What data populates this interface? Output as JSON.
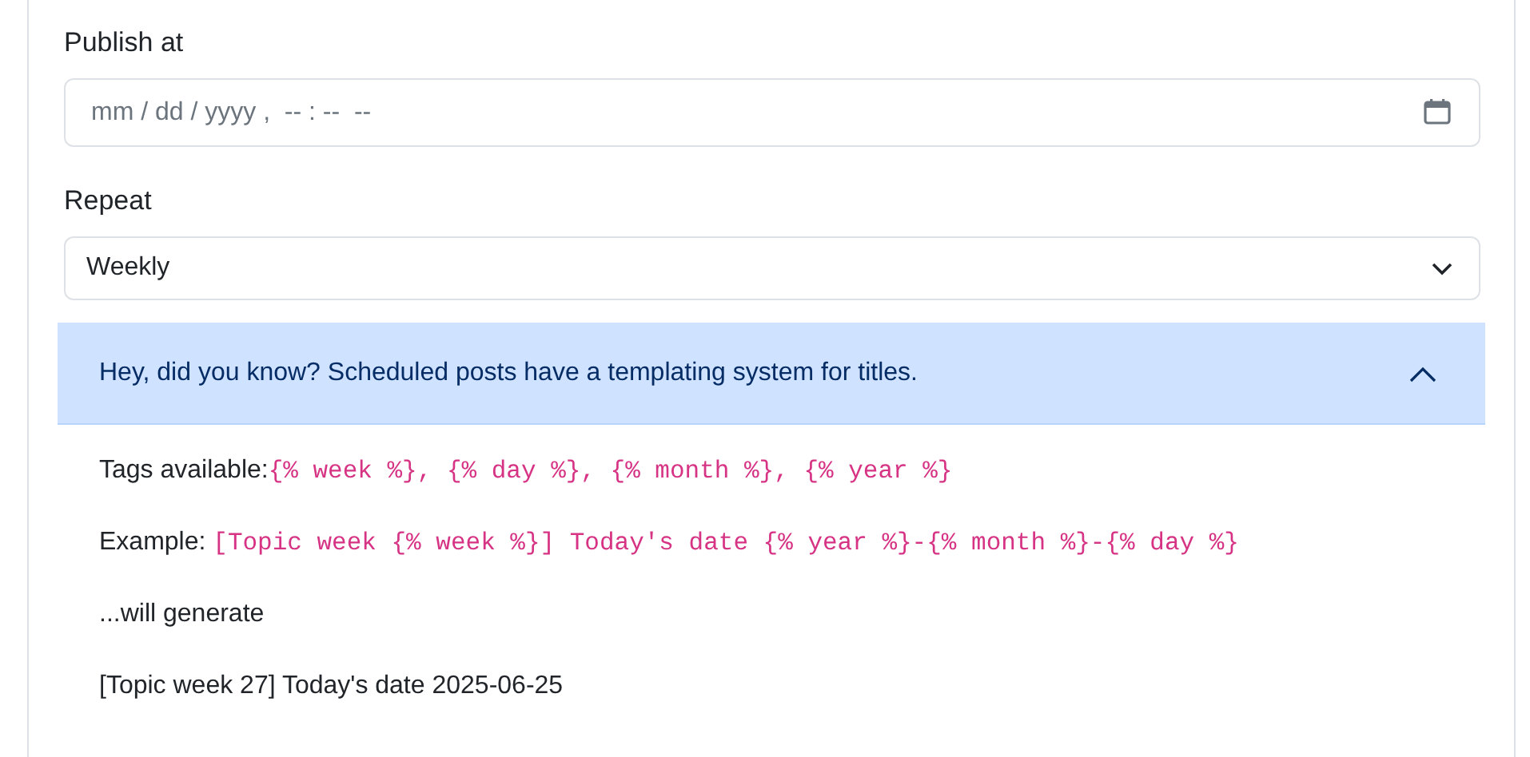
{
  "publish_at": {
    "label": "Publish at",
    "placeholder": "mm / dd / yyyy ,  -- : --  --"
  },
  "repeat": {
    "label": "Repeat",
    "value": "Weekly"
  },
  "tip": {
    "title": "Hey, did you know? Scheduled posts have a templating system for titles.",
    "expanded": true,
    "lines": [
      {
        "kind": "code",
        "label": "Tags available:",
        "code": "{% week %}, {% day %}, {% month %}, {% year %}"
      },
      {
        "kind": "code",
        "label": "Example: ",
        "code": "[Topic week {% week %}] Today's date {% year %}-{% month %}-{% day %}"
      },
      {
        "kind": "text",
        "text": "...will generate"
      },
      {
        "kind": "text",
        "text": "[Topic week 27] Today's date 2025-06-25"
      }
    ]
  }
}
